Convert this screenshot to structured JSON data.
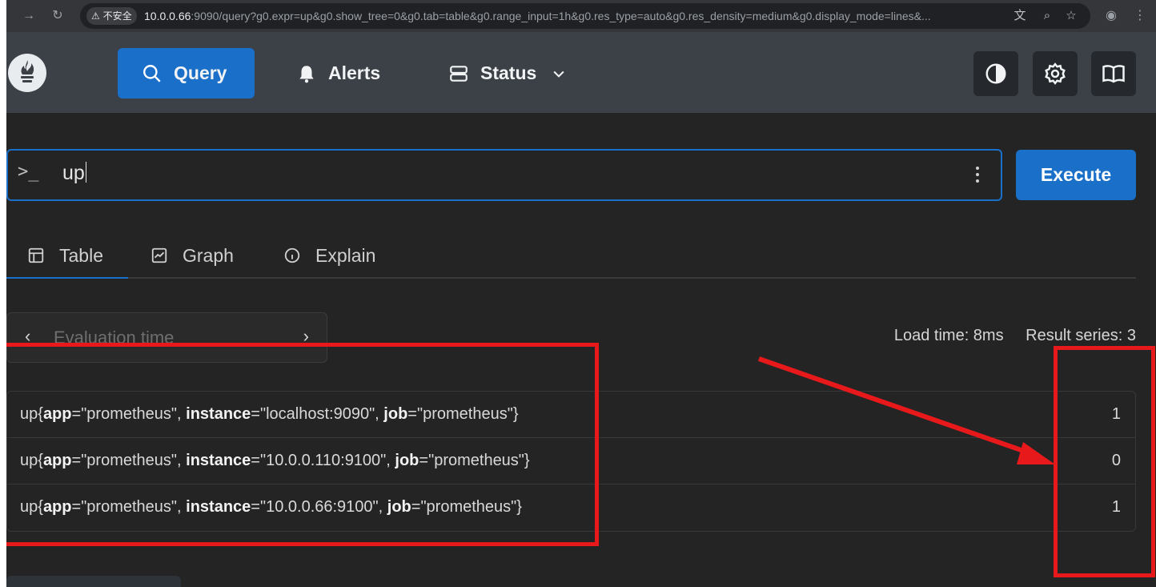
{
  "browser": {
    "secure_label": "⚠ 不安全",
    "url_host": "10.0.0.66",
    "url_rest": ":9090/query?g0.expr=up&g0.show_tree=0&g0.tab=table&g0.range_input=1h&g0.res_type=auto&g0.res_density=medium&g0.display_mode=lines&..."
  },
  "header": {
    "nav": {
      "query": "Query",
      "alerts": "Alerts",
      "status": "Status"
    }
  },
  "query": {
    "prompt": ">_",
    "expression": "up",
    "execute_label": "Execute"
  },
  "tabs": {
    "table": "Table",
    "graph": "Graph",
    "explain": "Explain",
    "active": "table"
  },
  "eval_time": {
    "placeholder": "Evaluation time"
  },
  "stats": {
    "load_time": "Load time: 8ms",
    "result_series": "Result series: 3"
  },
  "results": [
    {
      "metric": "up",
      "labels": [
        {
          "name": "app",
          "value": "\"prometheus\""
        },
        {
          "name": "instance",
          "value": "\"localhost:9090\""
        },
        {
          "name": "job",
          "value": "\"prometheus\""
        }
      ],
      "value": "1"
    },
    {
      "metric": "up",
      "labels": [
        {
          "name": "app",
          "value": "\"prometheus\""
        },
        {
          "name": "instance",
          "value": "\"10.0.0.110:9100\""
        },
        {
          "name": "job",
          "value": "\"prometheus\""
        }
      ],
      "value": "0"
    },
    {
      "metric": "up",
      "labels": [
        {
          "name": "app",
          "value": "\"prometheus\""
        },
        {
          "name": "instance",
          "value": "\"10.0.0.66:9100\""
        },
        {
          "name": "job",
          "value": "\"prometheus\""
        }
      ],
      "value": "1"
    }
  ],
  "colors": {
    "accent": "#1a6fc9",
    "annotation": "#e8191b",
    "header_bg": "#3b4147",
    "page_bg": "#242424"
  },
  "icons": {
    "logo": "prometheus-logo-icon",
    "query": "search-icon",
    "alerts": "bell-icon",
    "status": "server-icon",
    "theme": "contrast-icon",
    "settings": "gear-icon",
    "docs": "book-icon"
  }
}
